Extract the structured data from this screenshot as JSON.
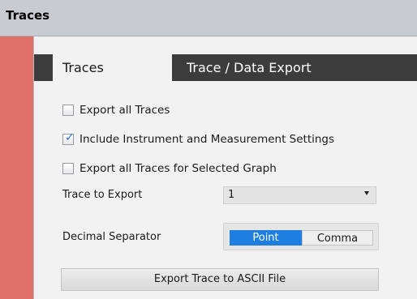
{
  "window": {
    "title": "Traces"
  },
  "tabs": [
    {
      "label": "Traces",
      "active": true
    },
    {
      "label": "Trace / Data Export",
      "active": false
    }
  ],
  "options": {
    "export_all_traces": {
      "label": "Export all Traces",
      "checked": false
    },
    "include_settings": {
      "label": "Include Instrument and Measurement Settings",
      "checked": true
    },
    "export_selected_graph": {
      "label": "Export all Traces for Selected Graph",
      "checked": false
    }
  },
  "trace_to_export": {
    "label": "Trace to Export",
    "value": "1"
  },
  "decimal_separator": {
    "label": "Decimal Separator",
    "options": [
      "Point",
      "Comma"
    ],
    "selected": "Point"
  },
  "export_button": {
    "label": "Export Trace to ASCII File"
  },
  "colors": {
    "accent": "#1e7fe1",
    "side_bar": "#e0706a",
    "tab_dark": "#3c3c3c"
  }
}
